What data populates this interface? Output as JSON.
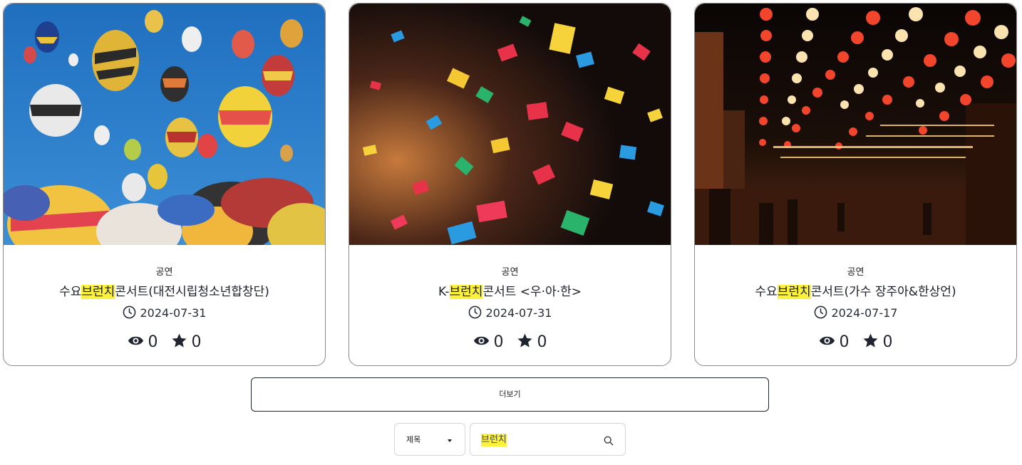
{
  "cards": [
    {
      "category": "공연",
      "title_pre": "수요",
      "title_hl": "브런치",
      "title_post": "콘서트(대전시립청소년합창단)",
      "date": "2024-07-31",
      "views": "0",
      "stars": "0",
      "image": "hot-air-balloons-photo"
    },
    {
      "category": "공연",
      "title_pre": "K-",
      "title_hl": "브런치",
      "title_post": "콘서트 <우·아·한>",
      "date": "2024-07-31",
      "views": "0",
      "stars": "0",
      "image": "confetti-photo"
    },
    {
      "category": "공연",
      "title_pre": "수요",
      "title_hl": "브런치",
      "title_post": "콘서트(가수 장주아&한상언)",
      "date": "2024-07-17",
      "views": "0",
      "stars": "0",
      "image": "lantern-festival-photo"
    }
  ],
  "more_button": "더보기",
  "search": {
    "field_select": "제목",
    "query": "브런치"
  },
  "colors": {
    "highlight": "#fdf23b",
    "text": "#1f2430",
    "border": "#8a8a8a"
  },
  "icons": [
    "clock-icon",
    "eye-icon",
    "star-icon",
    "search-icon",
    "caret-down-icon"
  ]
}
